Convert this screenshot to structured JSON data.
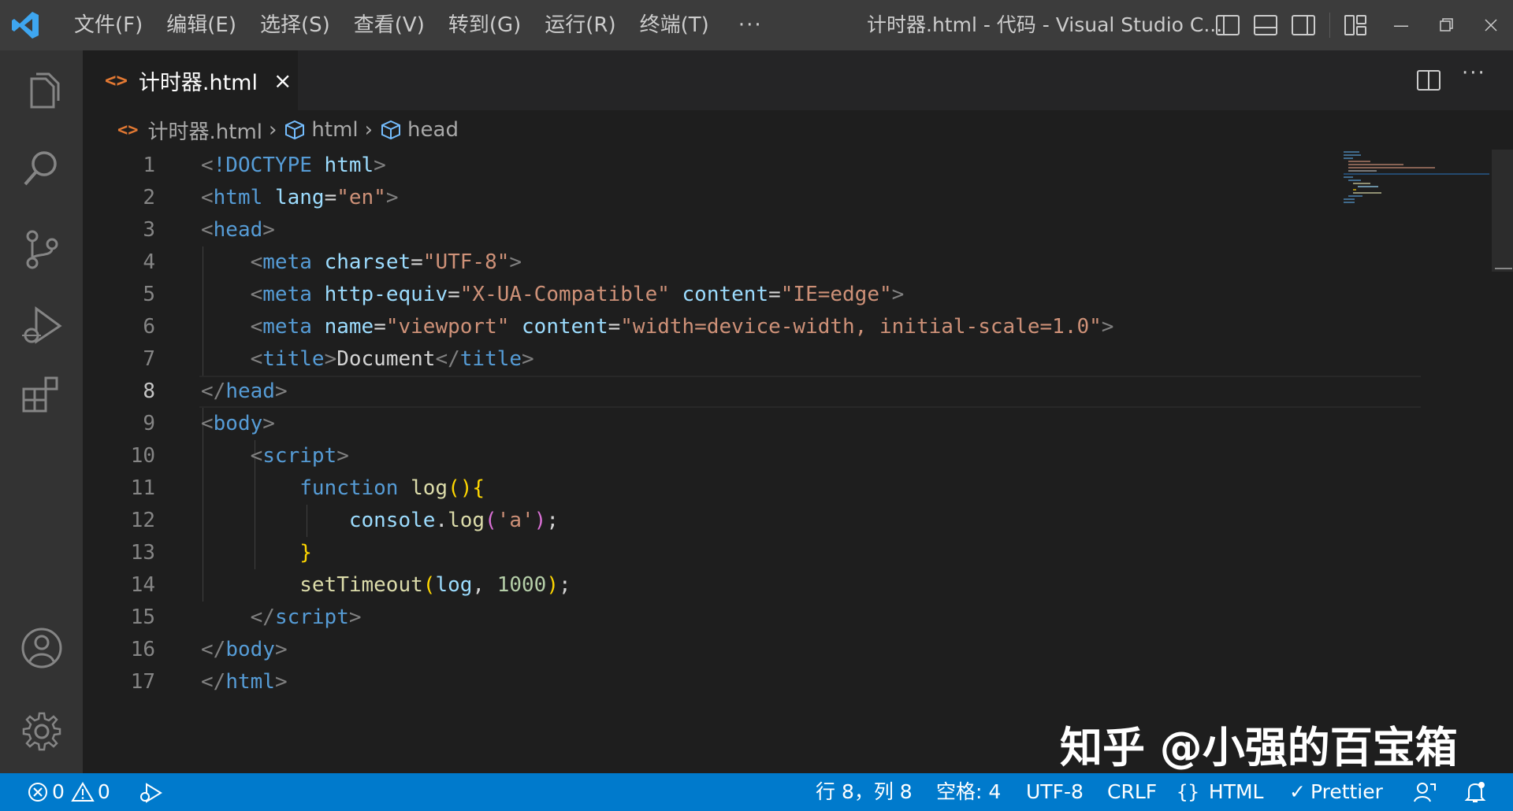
{
  "titlebar": {
    "menu": [
      "文件(F)",
      "编辑(E)",
      "选择(S)",
      "查看(V)",
      "转到(G)",
      "运行(R)",
      "终端(T)"
    ],
    "more": "···",
    "window_title": "计时器.html - 代码 - Visual Studio C..."
  },
  "tabs": [
    {
      "icon": "<>",
      "label": "计时器.html",
      "close": "×"
    }
  ],
  "breadcrumb": {
    "file": "计时器.html",
    "items": [
      "html",
      "head"
    ]
  },
  "editor": {
    "active_line": 8,
    "lines": [
      {
        "n": "1"
      },
      {
        "n": "2"
      },
      {
        "n": "3"
      },
      {
        "n": "4"
      },
      {
        "n": "5"
      },
      {
        "n": "6"
      },
      {
        "n": "7"
      },
      {
        "n": "8"
      },
      {
        "n": "9"
      },
      {
        "n": "10"
      },
      {
        "n": "11"
      },
      {
        "n": "12"
      },
      {
        "n": "13"
      },
      {
        "n": "14"
      },
      {
        "n": "15"
      },
      {
        "n": "16"
      },
      {
        "n": "17"
      }
    ],
    "code": [
      [
        [
          "t-punc",
          "<"
        ],
        [
          "t-tag",
          "!DOCTYPE "
        ],
        [
          "t-attr",
          "html"
        ],
        [
          "t-punc",
          ">"
        ]
      ],
      [
        [
          "t-punc",
          "<"
        ],
        [
          "t-tag",
          "html "
        ],
        [
          "t-attr",
          "lang"
        ],
        [
          "t-text",
          "="
        ],
        [
          "t-str",
          "\"en\""
        ],
        [
          "t-punc",
          ">"
        ]
      ],
      [
        [
          "t-punc",
          "<"
        ],
        [
          "t-tag",
          "head"
        ],
        [
          "t-punc",
          ">"
        ]
      ],
      [
        [
          "t-text",
          "    "
        ],
        [
          "t-punc",
          "<"
        ],
        [
          "t-tag",
          "meta "
        ],
        [
          "t-attr",
          "charset"
        ],
        [
          "t-text",
          "="
        ],
        [
          "t-str",
          "\"UTF-8\""
        ],
        [
          "t-punc",
          ">"
        ]
      ],
      [
        [
          "t-text",
          "    "
        ],
        [
          "t-punc",
          "<"
        ],
        [
          "t-tag",
          "meta "
        ],
        [
          "t-attr",
          "http-equiv"
        ],
        [
          "t-text",
          "="
        ],
        [
          "t-str",
          "\"X-UA-Compatible\" "
        ],
        [
          "t-attr",
          "content"
        ],
        [
          "t-text",
          "="
        ],
        [
          "t-str",
          "\"IE=edge\""
        ],
        [
          "t-punc",
          ">"
        ]
      ],
      [
        [
          "t-text",
          "    "
        ],
        [
          "t-punc",
          "<"
        ],
        [
          "t-tag",
          "meta "
        ],
        [
          "t-attr",
          "name"
        ],
        [
          "t-text",
          "="
        ],
        [
          "t-str",
          "\"viewport\" "
        ],
        [
          "t-attr",
          "content"
        ],
        [
          "t-text",
          "="
        ],
        [
          "t-str",
          "\"width=device-width, initial-scale=1.0\""
        ],
        [
          "t-punc",
          ">"
        ]
      ],
      [
        [
          "t-text",
          "    "
        ],
        [
          "t-punc",
          "<"
        ],
        [
          "t-tag",
          "title"
        ],
        [
          "t-punc",
          ">"
        ],
        [
          "t-text",
          "Document"
        ],
        [
          "t-punc",
          "</"
        ],
        [
          "t-tag",
          "title"
        ],
        [
          "t-punc",
          ">"
        ]
      ],
      [
        [
          "t-punc",
          "</"
        ],
        [
          "t-tag",
          "head"
        ],
        [
          "t-punc",
          ">"
        ]
      ],
      [
        [
          "t-punc",
          "<"
        ],
        [
          "t-tag",
          "body"
        ],
        [
          "t-punc",
          ">"
        ]
      ],
      [
        [
          "t-text",
          "    "
        ],
        [
          "t-punc",
          "<"
        ],
        [
          "t-tag",
          "script"
        ],
        [
          "t-punc",
          ">"
        ]
      ],
      [
        [
          "t-text",
          "        "
        ],
        [
          "t-kw",
          "function "
        ],
        [
          "t-fn",
          "log"
        ],
        [
          "t-br1",
          "(){"
        ]
      ],
      [
        [
          "t-text",
          "            "
        ],
        [
          "t-var",
          "console"
        ],
        [
          "t-text",
          "."
        ],
        [
          "t-fn",
          "log"
        ],
        [
          "t-br2",
          "("
        ],
        [
          "t-str",
          "'a'"
        ],
        [
          "t-br2",
          ")"
        ],
        [
          "t-text",
          ";"
        ]
      ],
      [
        [
          "t-text",
          "        "
        ],
        [
          "t-br1",
          "}"
        ]
      ],
      [
        [
          "t-text",
          "        "
        ],
        [
          "t-fn",
          "setTimeout"
        ],
        [
          "t-br1",
          "("
        ],
        [
          "t-var",
          "log"
        ],
        [
          "t-text",
          ", "
        ],
        [
          "t-num",
          "1000"
        ],
        [
          "t-br1",
          ")"
        ],
        [
          "t-text",
          ";"
        ]
      ],
      [
        [
          "t-text",
          "    "
        ],
        [
          "t-punc",
          "</"
        ],
        [
          "t-tag",
          "script"
        ],
        [
          "t-punc",
          ">"
        ]
      ],
      [
        [
          "t-punc",
          "</"
        ],
        [
          "t-tag",
          "body"
        ],
        [
          "t-punc",
          ">"
        ]
      ],
      [
        [
          "t-punc",
          "</"
        ],
        [
          "t-tag",
          "html"
        ],
        [
          "t-punc",
          ">"
        ]
      ]
    ]
  },
  "watermark": "知乎 @小强的百宝箱",
  "statusbar": {
    "errors": "0",
    "warnings": "0",
    "position": "行 8，列 8",
    "spaces": "空格: 4",
    "encoding": "UTF-8",
    "eol": "CRLF",
    "language": "HTML",
    "formatter": "Prettier"
  },
  "colors": {
    "titlebar": "#3c3c3c",
    "activitybar": "#333333",
    "editor_bg": "#1e1e1e",
    "statusbar": "#007acc",
    "html_icon": "#e37933"
  }
}
